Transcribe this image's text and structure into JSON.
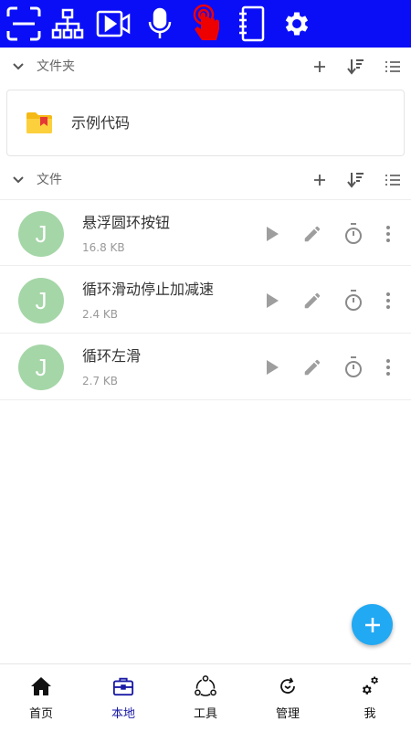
{
  "toolbar": {
    "icons": [
      "scan-icon",
      "sitemap-icon",
      "video-icon",
      "microphone-icon",
      "touch-icon",
      "notebook-icon",
      "gear-icon"
    ],
    "accent": "#0a0ef7"
  },
  "folders_section": {
    "title": "文件夹"
  },
  "folders": [
    {
      "name": "示例代码"
    }
  ],
  "files_section": {
    "title": "文件"
  },
  "files": [
    {
      "avatar": "J",
      "name": "悬浮圆环按钮",
      "size": "16.8 KB"
    },
    {
      "avatar": "J",
      "name": "循环滑动停止加减速",
      "size": "2.4 KB"
    },
    {
      "avatar": "J",
      "name": "循环左滑",
      "size": "2.7 KB"
    }
  ],
  "nav": {
    "items": [
      {
        "label": "首页",
        "icon": "home-icon"
      },
      {
        "label": "本地",
        "icon": "briefcase-icon"
      },
      {
        "label": "工具",
        "icon": "share-nodes-icon"
      },
      {
        "label": "管理",
        "icon": "refresh-icon"
      },
      {
        "label": "我",
        "icon": "gears-icon"
      }
    ],
    "active": "本地",
    "active_color": "#1a1aa6"
  },
  "fab_color": "#21a9f3"
}
